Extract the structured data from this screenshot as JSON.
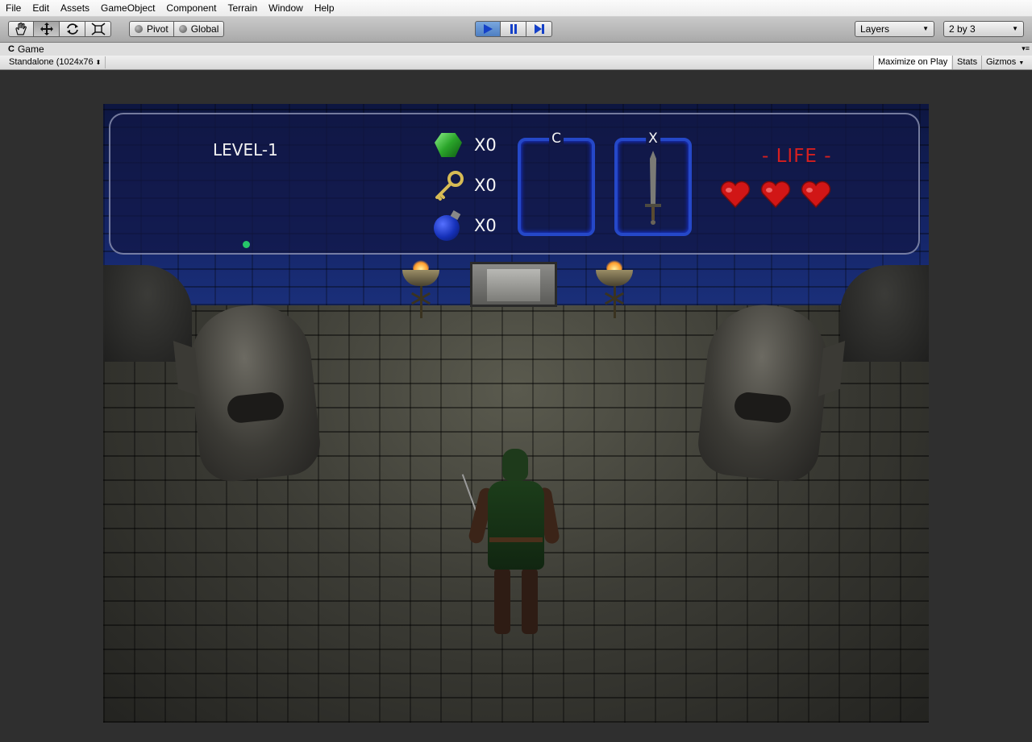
{
  "menu": [
    "File",
    "Edit",
    "Assets",
    "GameObject",
    "Component",
    "Terrain",
    "Window",
    "Help"
  ],
  "toolbar": {
    "tools": [
      "hand-icon",
      "move-icon",
      "rotate-icon",
      "scale-icon"
    ],
    "pivot_label": "Pivot",
    "global_label": "Global",
    "play_controls": [
      "play-icon",
      "pause-icon",
      "step-icon"
    ],
    "layers_label": "Layers",
    "layout_label": "2 by 3"
  },
  "game_panel": {
    "tab_title": "Game",
    "aspect_label": "Standalone (1024x76",
    "maximize_label": "Maximize on Play",
    "stats_label": "Stats",
    "gizmos_label": "Gizmos"
  },
  "hud": {
    "level": "LEVEL-1",
    "gems": "X0",
    "keys": "X0",
    "bombs": "X0",
    "slot_c_label": "C",
    "slot_x_label": "X",
    "life_label": "- LIFE -",
    "hearts": 3,
    "colors": {
      "life": "#d71f1f",
      "slot_border": "#2548c8",
      "minimap_dot": "#26c76a"
    }
  }
}
